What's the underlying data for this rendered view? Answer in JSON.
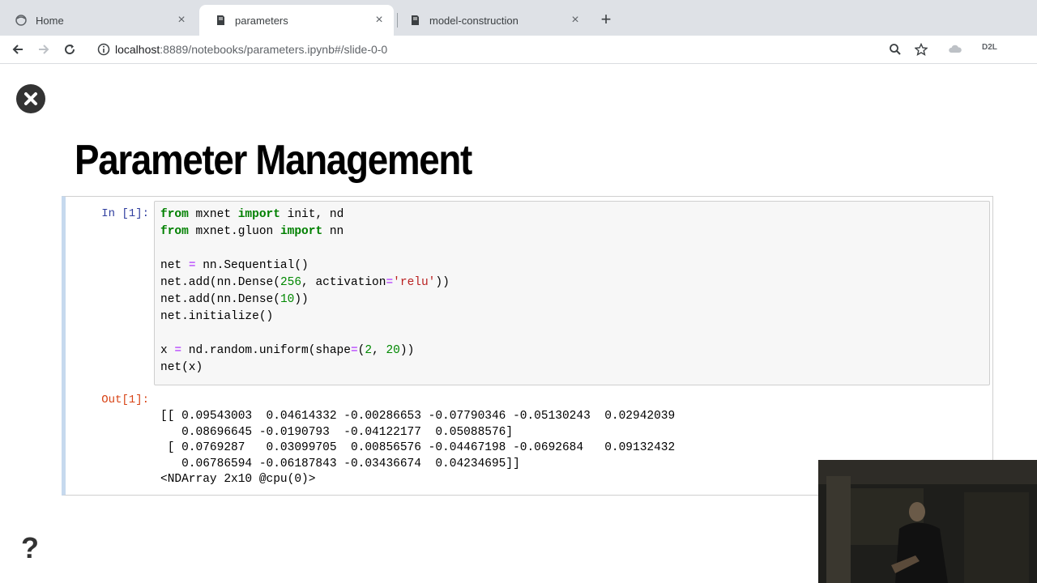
{
  "browser": {
    "tabs": [
      {
        "title": "Home",
        "active": false,
        "icon": "jupyter-icon"
      },
      {
        "title": "parameters",
        "active": true,
        "icon": "notebook-icon"
      },
      {
        "title": "model-construction",
        "active": false,
        "icon": "notebook-icon"
      }
    ],
    "new_tab": "+",
    "url_host": "localhost",
    "url_path": ":8889/notebooks/parameters.ipynb#/slide-0-0",
    "extension_label": "D2L"
  },
  "slide": {
    "title": "Parameter Management",
    "exit_icon": "close-circle-icon",
    "help_icon": "?"
  },
  "cell": {
    "in_prompt": "In [1]:",
    "out_prompt": "Out[1]:",
    "code": [
      [
        {
          "t": "from",
          "k": "kw"
        },
        {
          "t": " mxnet "
        },
        {
          "t": "import",
          "k": "kw"
        },
        {
          "t": " init, nd"
        }
      ],
      [
        {
          "t": "from",
          "k": "kw"
        },
        {
          "t": " mxnet.gluon "
        },
        {
          "t": "import",
          "k": "kw"
        },
        {
          "t": " nn"
        }
      ],
      [
        {
          "t": ""
        }
      ],
      [
        {
          "t": "net "
        },
        {
          "t": "=",
          "k": "op"
        },
        {
          "t": " nn.Sequential()"
        }
      ],
      [
        {
          "t": "net.add(nn.Dense("
        },
        {
          "t": "256",
          "k": "num"
        },
        {
          "t": ", activation"
        },
        {
          "t": "=",
          "k": "op"
        },
        {
          "t": "'relu'",
          "k": "str"
        },
        {
          "t": "))"
        }
      ],
      [
        {
          "t": "net.add(nn.Dense("
        },
        {
          "t": "10",
          "k": "num"
        },
        {
          "t": "))"
        }
      ],
      [
        {
          "t": "net.initialize()"
        }
      ],
      [
        {
          "t": ""
        }
      ],
      [
        {
          "t": "x "
        },
        {
          "t": "=",
          "k": "op"
        },
        {
          "t": " nd.random.uniform(shape"
        },
        {
          "t": "=",
          "k": "op"
        },
        {
          "t": "("
        },
        {
          "t": "2",
          "k": "num"
        },
        {
          "t": ", "
        },
        {
          "t": "20",
          "k": "num"
        },
        {
          "t": "))"
        }
      ],
      [
        {
          "t": "net(x)"
        }
      ]
    ],
    "output": [
      "[[ 0.09543003  0.04614332 -0.00286653 -0.07790346 -0.05130243  0.02942039",
      "   0.08696645 -0.0190793  -0.04122177  0.05088576]",
      " [ 0.0769287   0.03099705  0.00856576 -0.04467198 -0.0692684   0.09132432",
      "   0.06786594 -0.06187843 -0.03436674  0.04234695]]",
      "<NDArray 2x10 @cpu(0)>"
    ]
  }
}
